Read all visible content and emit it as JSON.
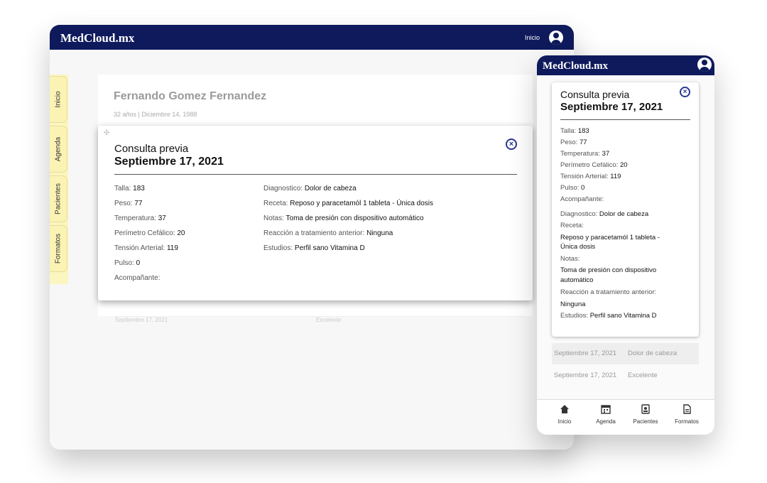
{
  "desktop": {
    "brand": "MedCloud.mx",
    "home_link": "Inicio",
    "side_tabs": [
      "Inicio",
      "Agenda",
      "Pacientes",
      "Formatos"
    ],
    "patient": {
      "name": "Fernando Gomez Fernandez",
      "sub": "32 años | Diciembre 14, 1988"
    },
    "bg_row": {
      "date": "Septiembre 17, 2021",
      "status": "Excelente"
    }
  },
  "consulta": {
    "title": "Consulta previa",
    "date": "Septiembre 17, 2021",
    "fields": {
      "talla_k": "Talla:",
      "talla_v": "183",
      "peso_k": "Peso:",
      "peso_v": "77",
      "temp_k": "Temperatura:",
      "temp_v": "37",
      "perim_k": "Perímetro Cefálico:",
      "perim_v": "20",
      "tension_k": "Tensión Arterial:",
      "tension_v": "119",
      "pulso_k": "Pulso:",
      "pulso_v": "0",
      "acomp_k": "Acompañante:",
      "diag_k": "Diagnostico:",
      "diag_v": "Dolor de cabeza",
      "receta_k": "Receta:",
      "receta_v": "Reposo y paracetamól 1 tableta - Única dosis",
      "receta_v1": "Reposo y paracetamól 1 tableta -",
      "receta_v2": "Única dosis",
      "notas_k": "Notas:",
      "notas_v": "Toma de presión con dispositivo automático",
      "notas_v1": "Toma de presión con dispositivo",
      "notas_v2": "automático",
      "reac_k": "Reacción a tratamiento anterior:",
      "reac_v": "Ninguna",
      "estudios_k": "Estudios:",
      "estudios_v": "Perfil sano Vitamina D"
    }
  },
  "mobile": {
    "brand": "MedCloud.mx",
    "rows": [
      {
        "date": "Septiembre 17, 2021",
        "text": "Dolor de cabeza"
      },
      {
        "date": "Septiembre 17, 2021",
        "text": "Excelente"
      }
    ],
    "nav": [
      {
        "label": "Inicio",
        "icon": "home-icon"
      },
      {
        "label": "Agenda",
        "icon": "calendar-icon"
      },
      {
        "label": "Pacientes",
        "icon": "contacts-icon"
      },
      {
        "label": "Formatos",
        "icon": "document-icon"
      }
    ]
  },
  "colors": {
    "navy": "#0e1a5c",
    "tab_yellow": "#fbf3b4",
    "close_blue": "#2a3690"
  }
}
